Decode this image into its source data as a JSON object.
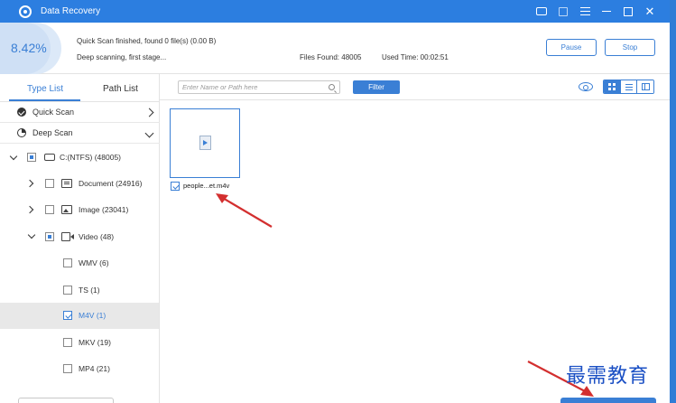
{
  "window": {
    "title": "Data Recovery"
  },
  "status": {
    "percent": "8.42%",
    "message1": "Quick Scan finished, found 0 file(s) (0.00  B)",
    "message2": "Deep scanning, first stage...",
    "files_found": "Files Found: 48005",
    "used_time": "Used Time: 00:02:51",
    "pause_label": "Pause",
    "stop_label": "Stop"
  },
  "tabs": {
    "type_list": "Type List",
    "path_list": "Path List"
  },
  "scans": {
    "quick": "Quick Scan",
    "deep": "Deep Scan"
  },
  "tree": {
    "drive": "C:(NTFS) (48005)",
    "document": "Document (24916)",
    "image": "Image (23041)",
    "video": "Video (48)",
    "wmv": "WMV (6)",
    "ts": "TS (1)",
    "m4v": "M4V (1)",
    "mkv": "MKV (19)",
    "mp4": "MP4 (21)"
  },
  "toolbar": {
    "search_placeholder": "Enter Name or Path here",
    "filter_label": "Filter"
  },
  "files": [
    {
      "name": "people...et.m4v"
    }
  ],
  "watermark": "最需教育",
  "colors": {
    "accent": "#3a7fd5",
    "titlebar": "#2c7ee0",
    "annotation_arrow": "#d32f2f"
  }
}
